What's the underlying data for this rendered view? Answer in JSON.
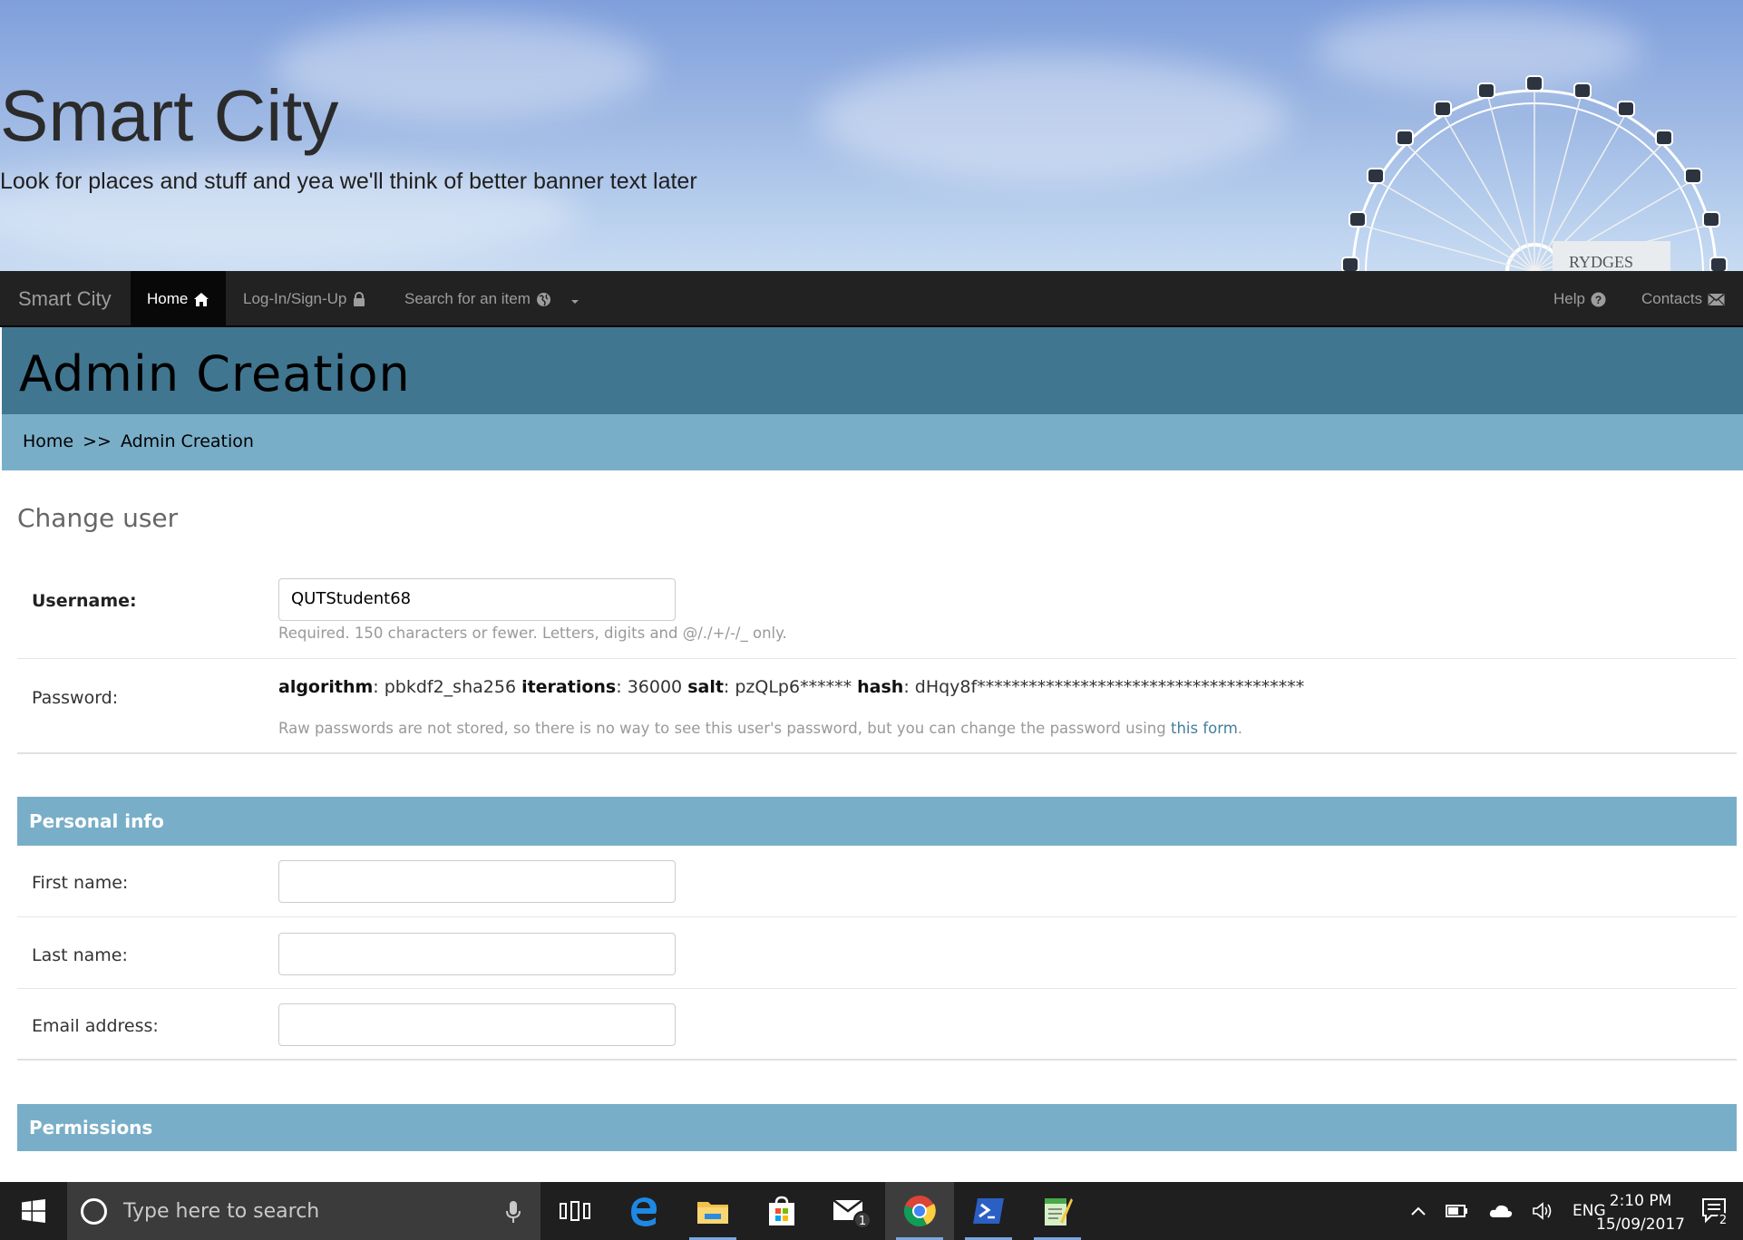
{
  "banner": {
    "title": "Smart City",
    "subtitle": "Look for places and stuff and yea we'll think of better banner text later",
    "sign_text": "RYDGES"
  },
  "navbar": {
    "brand": "Smart City",
    "items": [
      {
        "label": "Home",
        "icon": "home-icon",
        "active": true
      },
      {
        "label": "Log-In/Sign-Up",
        "icon": "lock-icon"
      },
      {
        "label": "Search for an item",
        "icon": "globe-icon",
        "dropdown": true
      }
    ],
    "right_items": [
      {
        "label": "Help",
        "icon": "question-circle-icon"
      },
      {
        "label": "Contacts",
        "icon": "envelope-icon"
      }
    ]
  },
  "header": {
    "title": "Admin Creation"
  },
  "breadcrumbs": {
    "home": "Home",
    "separator": ">>",
    "current": "Admin Creation"
  },
  "content": {
    "title": "Change user",
    "username": {
      "label": "Username:",
      "value": "QUTStudent68",
      "help": "Required. 150 characters or fewer. Letters, digits and @/./+/-/_ only."
    },
    "password": {
      "label": "Password:",
      "algorithm_label": "algorithm",
      "algorithm_value": ": pbkdf2_sha256 ",
      "iterations_label": "iterations",
      "iterations_value": ": 36000 ",
      "salt_label": "salt",
      "salt_value": ": pzQLp6****** ",
      "hash_label": "hash",
      "hash_value": ": dHqy8f**************************************",
      "help_text": "Raw passwords are not stored, so there is no way to see this user's password, but you can change the password using ",
      "help_link": "this form",
      "help_end": "."
    },
    "personal_info": {
      "heading": "Personal info",
      "first_name": {
        "label": "First name:",
        "value": ""
      },
      "last_name": {
        "label": "Last name:",
        "value": ""
      },
      "email": {
        "label": "Email address:",
        "value": ""
      }
    },
    "permissions": {
      "heading": "Permissions"
    }
  },
  "taskbar": {
    "search_placeholder": "Type here to search",
    "apps": [
      "task-view-icon",
      "edge-icon",
      "file-explorer-icon",
      "store-icon",
      "mail-icon",
      "chrome-icon",
      "powershell-icon",
      "notepad-icon"
    ],
    "mail_badge": "1",
    "language": "ENG",
    "time": "2:10 PM",
    "date": "15/09/2017",
    "notification_count": "2"
  },
  "colors": {
    "navbar": "#222222",
    "header": "#417690",
    "breadcrumbs": "#79aec8",
    "section_head": "#79aec8",
    "link": "#447e9b",
    "taskbar": "#1f1f1f"
  }
}
